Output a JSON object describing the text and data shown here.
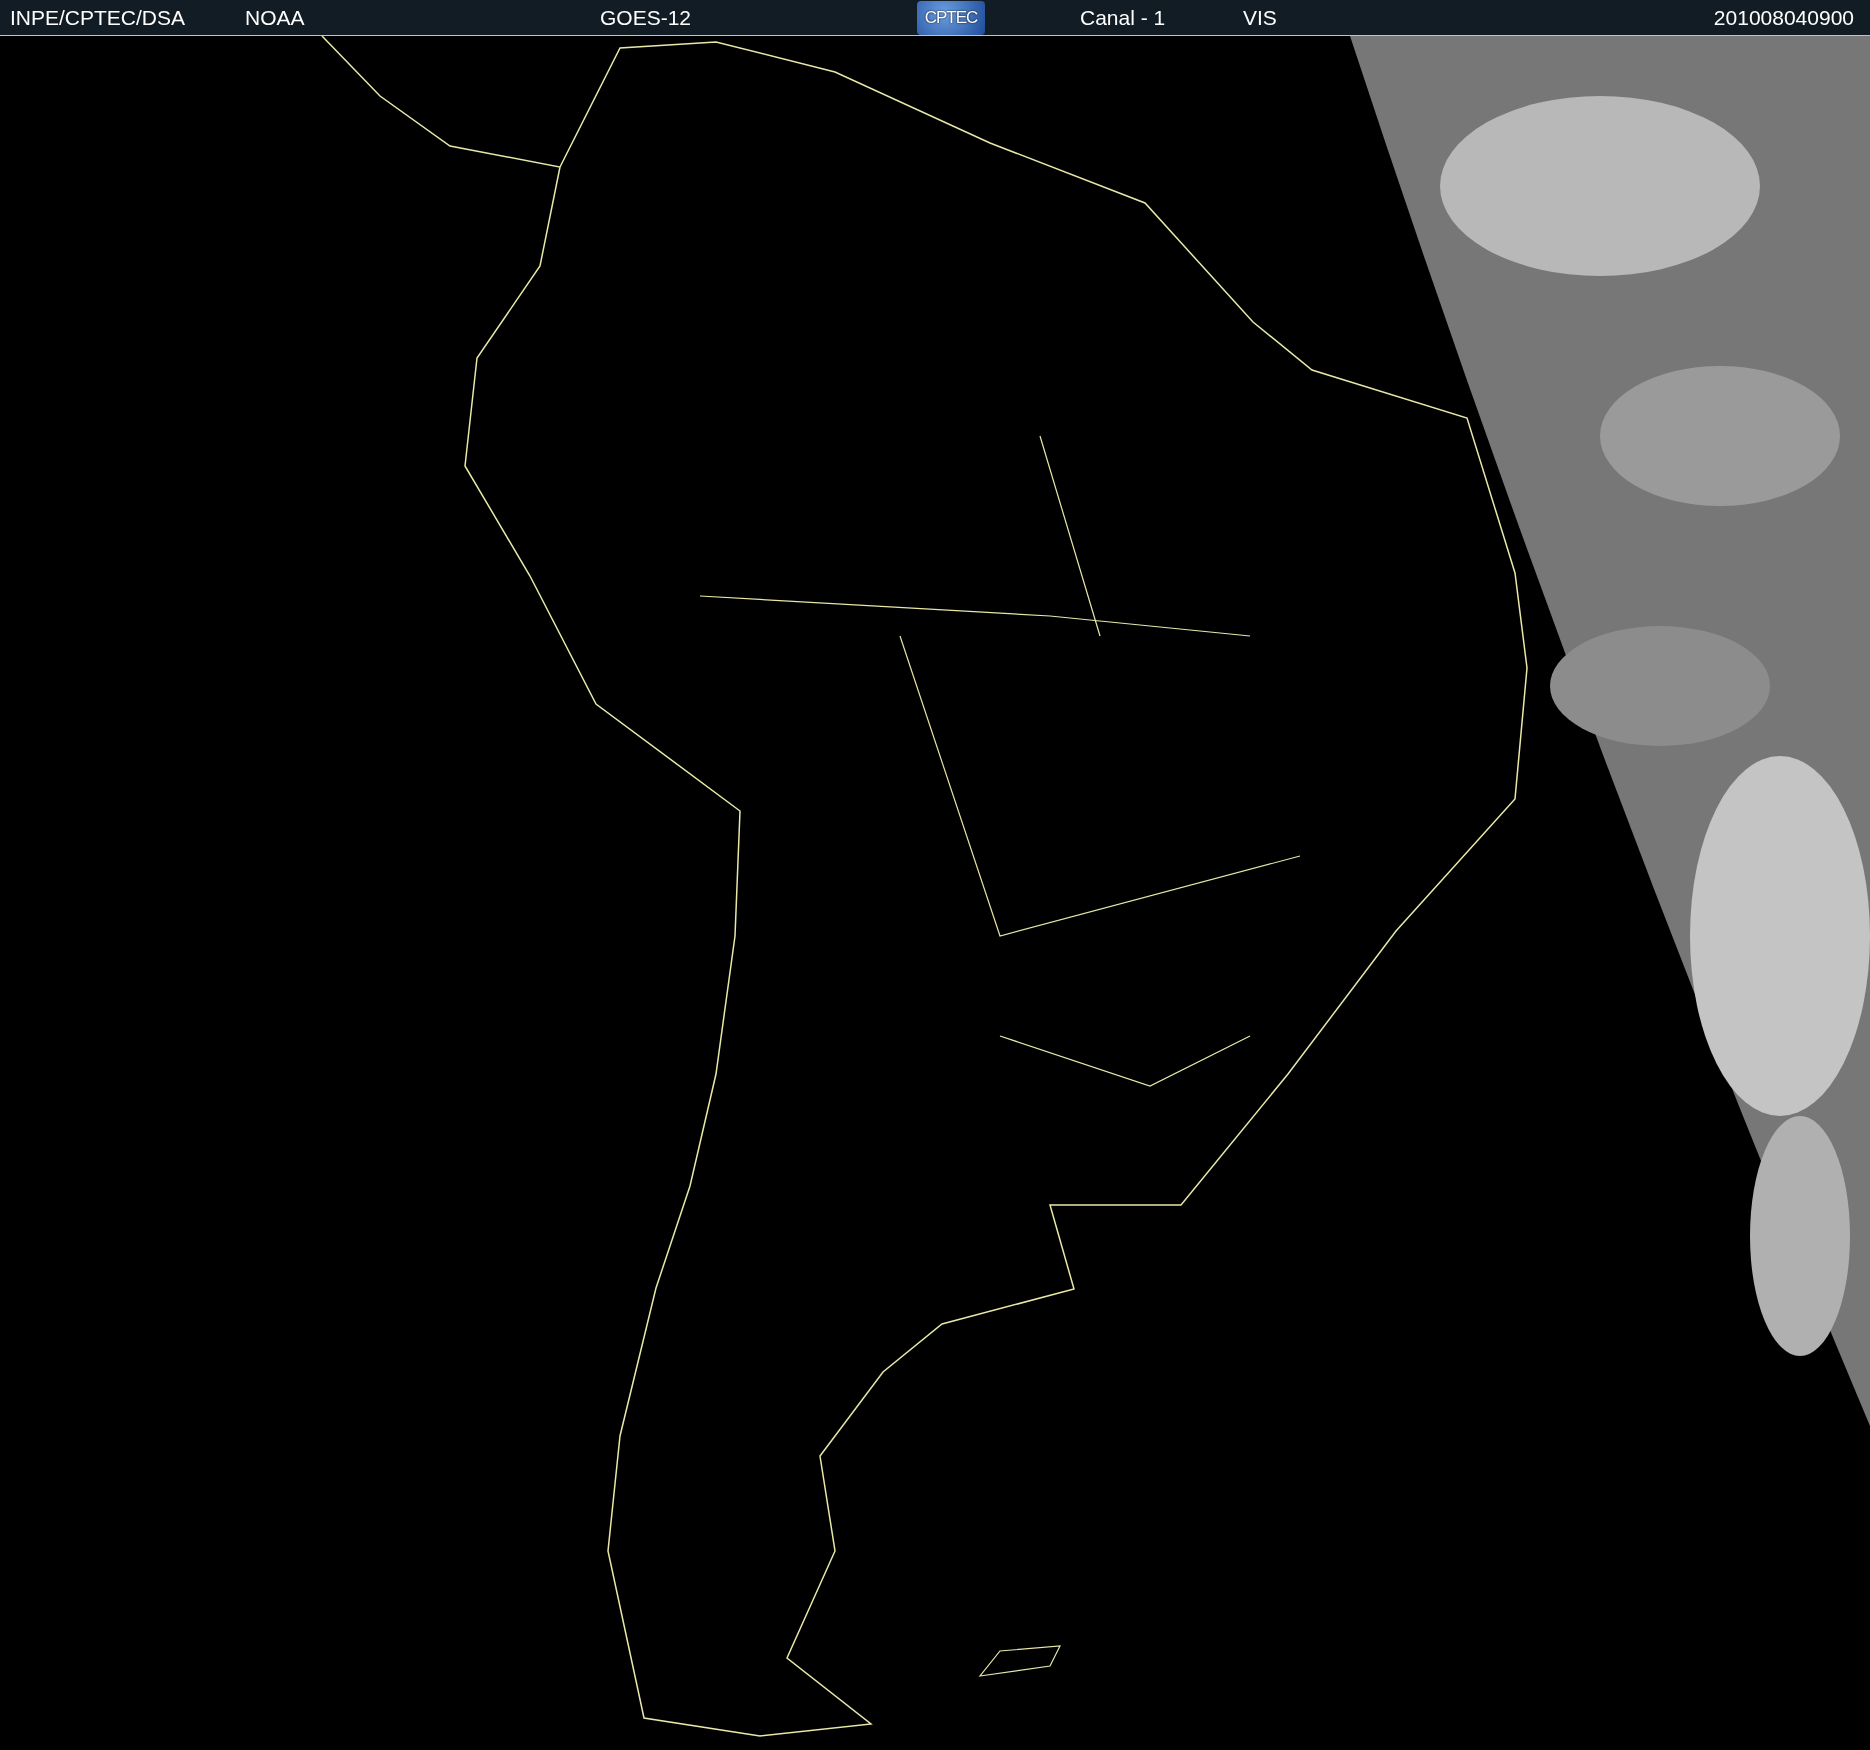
{
  "header": {
    "source": "INPE/CPTEC/DSA",
    "agency": "NOAA",
    "satellite": "GOES-12",
    "logo_text": "CPTEC",
    "channel": "Canal - 1",
    "band": "VIS",
    "timestamp": "201008040900"
  }
}
